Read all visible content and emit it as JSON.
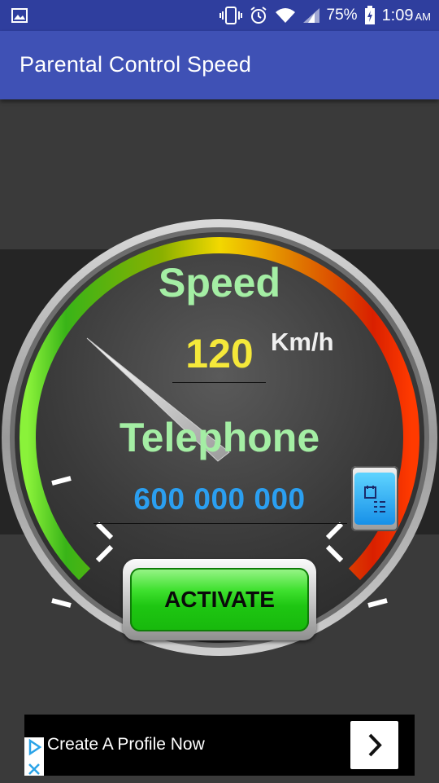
{
  "status_bar": {
    "battery_percent": "75%",
    "time": "1:09",
    "ampm": "AM",
    "icons": [
      "gallery-icon",
      "vibrate-icon",
      "alarm-icon",
      "wifi-icon",
      "signal-icon",
      "battery-charging-icon"
    ]
  },
  "app_bar": {
    "title": "Parental Control Speed"
  },
  "gauge": {
    "speed_label": "Speed",
    "speed_value": "120",
    "speed_unit": "Km/h",
    "telephone_label": "Telephone",
    "telephone_value": "600 000 000",
    "contacts_icon": "contacts-list-icon"
  },
  "activate": {
    "label": "ACTIVATE"
  },
  "ad": {
    "text": "Create A Profile Now",
    "icons": [
      "adchoices-icon",
      "close-icon",
      "chevron-right-icon"
    ]
  },
  "colors": {
    "status_bar": "#2f3e9e",
    "app_bar": "#3f51b5",
    "label_green": "#a4eea4",
    "speed_yellow": "#f5e83a",
    "phone_blue": "#2b9ff0",
    "button_green": "#3fe12f"
  }
}
